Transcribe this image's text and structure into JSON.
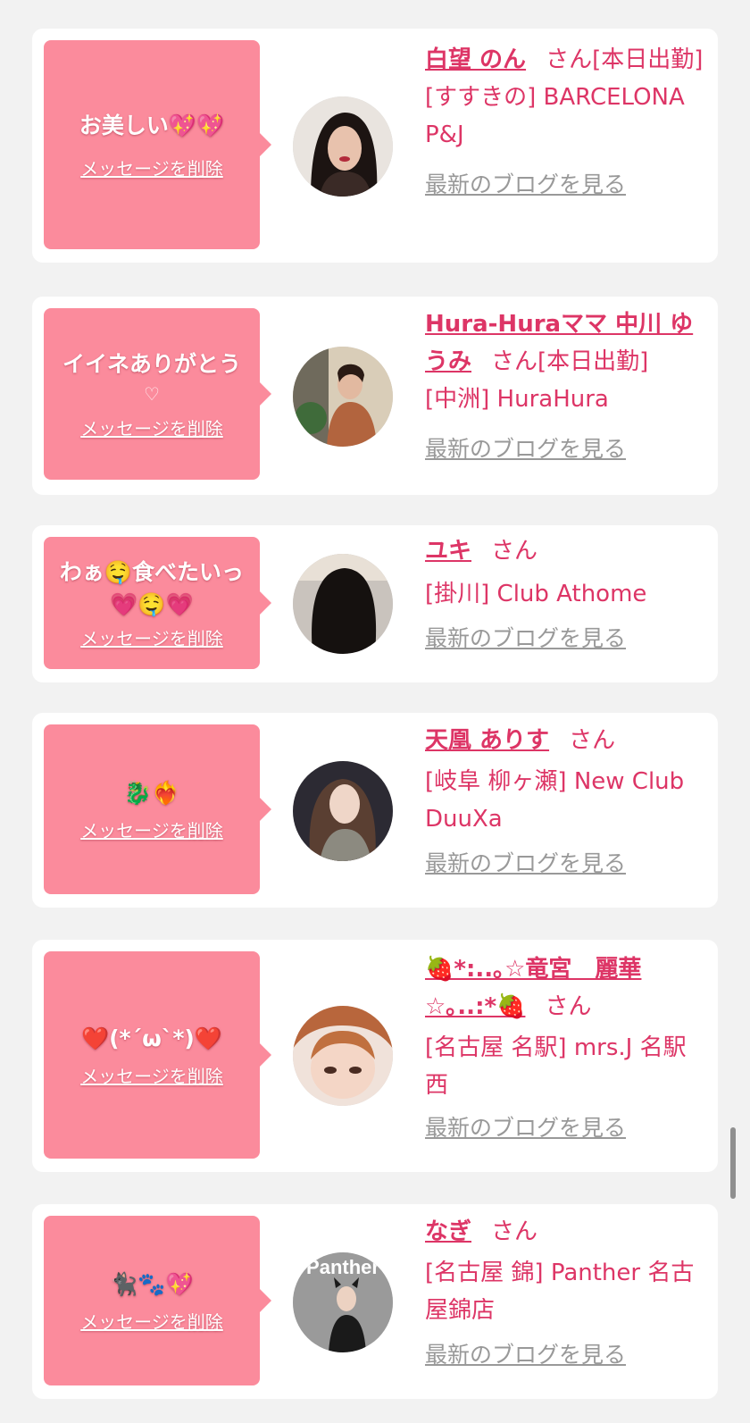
{
  "delete_label": "メッセージを削除",
  "blog_label": "最新のブログを見る",
  "honorific": "さん",
  "colors": {
    "bubble": "#fb8b9c",
    "accent": "#dd3566",
    "link_gray": "#999999",
    "background": "#f2f2f2"
  },
  "cards": [
    {
      "message": "お美しい💖💖",
      "name": "白望 のん",
      "status": "[本日出勤]",
      "shop": "[すすきの] BARCELONA P&J"
    },
    {
      "message": "イイネありがとう",
      "message_sub": "♡",
      "name": "Hura-Huraママ 中川 ゆうみ",
      "status": "[本日出勤]",
      "shop": "[中洲] HuraHura"
    },
    {
      "message": "わぁ🤤食べたいっ💗🤤💗",
      "name": "ユキ",
      "status": "",
      "shop": "[掛川] Club Athome"
    },
    {
      "message": "🐉❤️‍🔥",
      "name": "天凰 ありす",
      "status": "",
      "shop": "[岐阜 柳ヶ瀬] New Club DuuXa"
    },
    {
      "message": "❤️(*´ω`*)❤️",
      "name": "🍓*:..｡☆竜宮　麗華☆｡..:*🍓",
      "status": "",
      "shop": "[名古屋 名駅] mrs.J 名駅西"
    },
    {
      "message": "🐈‍⬛🐾💖",
      "name": "なぎ",
      "status": "",
      "shop": "[名古屋 錦] Panther 名古屋錦店",
      "avatar_text": "Panther"
    }
  ]
}
